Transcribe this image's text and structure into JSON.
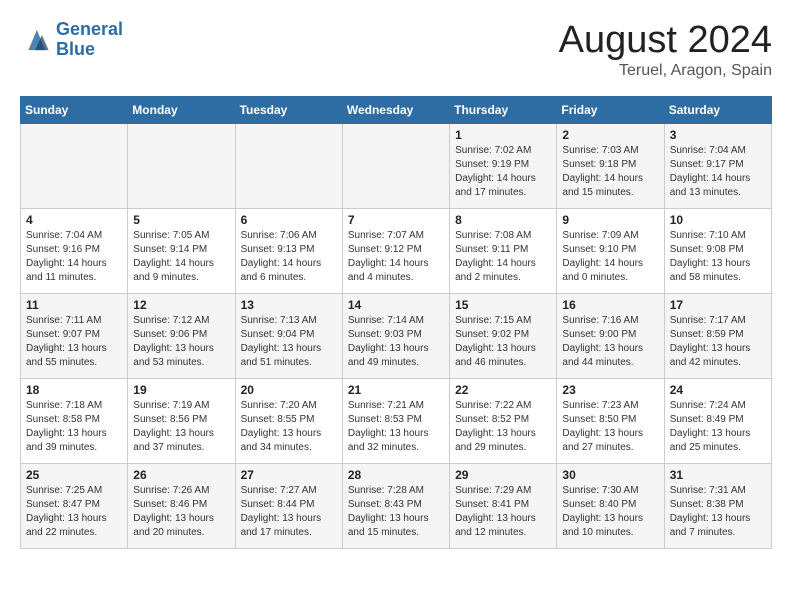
{
  "header": {
    "logo_line1": "General",
    "logo_line2": "Blue",
    "month": "August 2024",
    "location": "Teruel, Aragon, Spain"
  },
  "weekdays": [
    "Sunday",
    "Monday",
    "Tuesday",
    "Wednesday",
    "Thursday",
    "Friday",
    "Saturday"
  ],
  "weeks": [
    [
      {
        "day": "",
        "info": ""
      },
      {
        "day": "",
        "info": ""
      },
      {
        "day": "",
        "info": ""
      },
      {
        "day": "",
        "info": ""
      },
      {
        "day": "1",
        "info": "Sunrise: 7:02 AM\nSunset: 9:19 PM\nDaylight: 14 hours\nand 17 minutes."
      },
      {
        "day": "2",
        "info": "Sunrise: 7:03 AM\nSunset: 9:18 PM\nDaylight: 14 hours\nand 15 minutes."
      },
      {
        "day": "3",
        "info": "Sunrise: 7:04 AM\nSunset: 9:17 PM\nDaylight: 14 hours\nand 13 minutes."
      }
    ],
    [
      {
        "day": "4",
        "info": "Sunrise: 7:04 AM\nSunset: 9:16 PM\nDaylight: 14 hours\nand 11 minutes."
      },
      {
        "day": "5",
        "info": "Sunrise: 7:05 AM\nSunset: 9:14 PM\nDaylight: 14 hours\nand 9 minutes."
      },
      {
        "day": "6",
        "info": "Sunrise: 7:06 AM\nSunset: 9:13 PM\nDaylight: 14 hours\nand 6 minutes."
      },
      {
        "day": "7",
        "info": "Sunrise: 7:07 AM\nSunset: 9:12 PM\nDaylight: 14 hours\nand 4 minutes."
      },
      {
        "day": "8",
        "info": "Sunrise: 7:08 AM\nSunset: 9:11 PM\nDaylight: 14 hours\nand 2 minutes."
      },
      {
        "day": "9",
        "info": "Sunrise: 7:09 AM\nSunset: 9:10 PM\nDaylight: 14 hours\nand 0 minutes."
      },
      {
        "day": "10",
        "info": "Sunrise: 7:10 AM\nSunset: 9:08 PM\nDaylight: 13 hours\nand 58 minutes."
      }
    ],
    [
      {
        "day": "11",
        "info": "Sunrise: 7:11 AM\nSunset: 9:07 PM\nDaylight: 13 hours\nand 55 minutes."
      },
      {
        "day": "12",
        "info": "Sunrise: 7:12 AM\nSunset: 9:06 PM\nDaylight: 13 hours\nand 53 minutes."
      },
      {
        "day": "13",
        "info": "Sunrise: 7:13 AM\nSunset: 9:04 PM\nDaylight: 13 hours\nand 51 minutes."
      },
      {
        "day": "14",
        "info": "Sunrise: 7:14 AM\nSunset: 9:03 PM\nDaylight: 13 hours\nand 49 minutes."
      },
      {
        "day": "15",
        "info": "Sunrise: 7:15 AM\nSunset: 9:02 PM\nDaylight: 13 hours\nand 46 minutes."
      },
      {
        "day": "16",
        "info": "Sunrise: 7:16 AM\nSunset: 9:00 PM\nDaylight: 13 hours\nand 44 minutes."
      },
      {
        "day": "17",
        "info": "Sunrise: 7:17 AM\nSunset: 8:59 PM\nDaylight: 13 hours\nand 42 minutes."
      }
    ],
    [
      {
        "day": "18",
        "info": "Sunrise: 7:18 AM\nSunset: 8:58 PM\nDaylight: 13 hours\nand 39 minutes."
      },
      {
        "day": "19",
        "info": "Sunrise: 7:19 AM\nSunset: 8:56 PM\nDaylight: 13 hours\nand 37 minutes."
      },
      {
        "day": "20",
        "info": "Sunrise: 7:20 AM\nSunset: 8:55 PM\nDaylight: 13 hours\nand 34 minutes."
      },
      {
        "day": "21",
        "info": "Sunrise: 7:21 AM\nSunset: 8:53 PM\nDaylight: 13 hours\nand 32 minutes."
      },
      {
        "day": "22",
        "info": "Sunrise: 7:22 AM\nSunset: 8:52 PM\nDaylight: 13 hours\nand 29 minutes."
      },
      {
        "day": "23",
        "info": "Sunrise: 7:23 AM\nSunset: 8:50 PM\nDaylight: 13 hours\nand 27 minutes."
      },
      {
        "day": "24",
        "info": "Sunrise: 7:24 AM\nSunset: 8:49 PM\nDaylight: 13 hours\nand 25 minutes."
      }
    ],
    [
      {
        "day": "25",
        "info": "Sunrise: 7:25 AM\nSunset: 8:47 PM\nDaylight: 13 hours\nand 22 minutes."
      },
      {
        "day": "26",
        "info": "Sunrise: 7:26 AM\nSunset: 8:46 PM\nDaylight: 13 hours\nand 20 minutes."
      },
      {
        "day": "27",
        "info": "Sunrise: 7:27 AM\nSunset: 8:44 PM\nDaylight: 13 hours\nand 17 minutes."
      },
      {
        "day": "28",
        "info": "Sunrise: 7:28 AM\nSunset: 8:43 PM\nDaylight: 13 hours\nand 15 minutes."
      },
      {
        "day": "29",
        "info": "Sunrise: 7:29 AM\nSunset: 8:41 PM\nDaylight: 13 hours\nand 12 minutes."
      },
      {
        "day": "30",
        "info": "Sunrise: 7:30 AM\nSunset: 8:40 PM\nDaylight: 13 hours\nand 10 minutes."
      },
      {
        "day": "31",
        "info": "Sunrise: 7:31 AM\nSunset: 8:38 PM\nDaylight: 13 hours\nand 7 minutes."
      }
    ]
  ]
}
